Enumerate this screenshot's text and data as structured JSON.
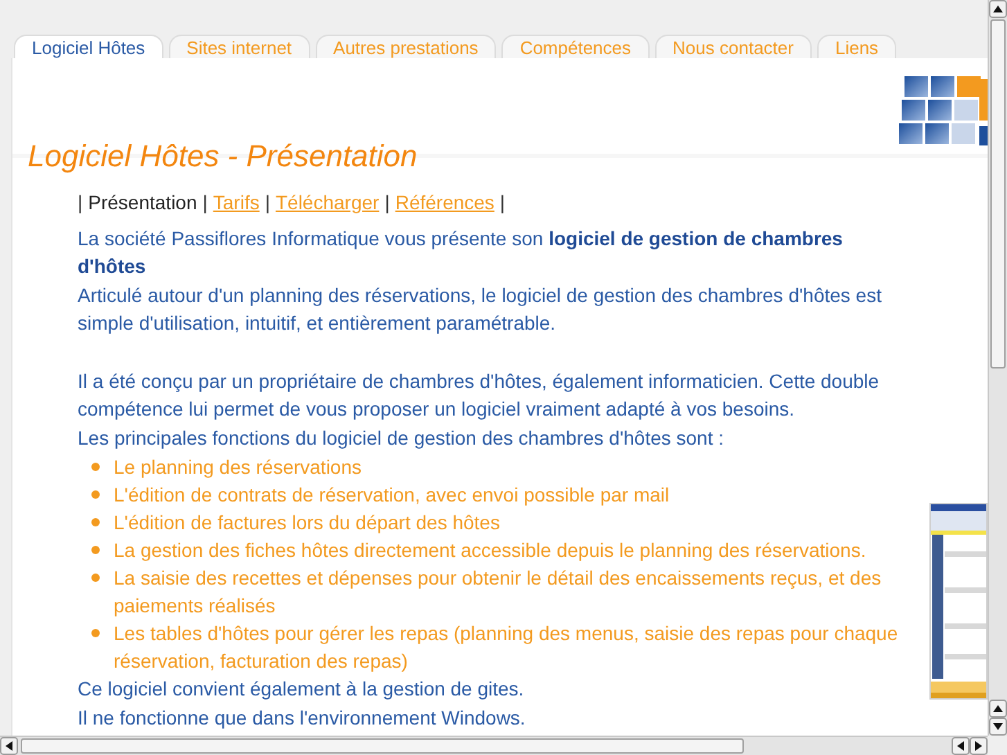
{
  "tabs": [
    {
      "label": "Logiciel Hôtes",
      "selected": true
    },
    {
      "label": "Sites internet",
      "selected": false
    },
    {
      "label": "Autres prestations",
      "selected": false
    },
    {
      "label": "Compétences",
      "selected": false
    },
    {
      "label": "Nous contacter",
      "selected": false
    },
    {
      "label": "Liens",
      "selected": false
    }
  ],
  "page_title": "Logiciel Hôtes - Présentation",
  "subnav": [
    {
      "kind": "separator",
      "text": "|"
    },
    {
      "kind": "link",
      "text": "Présentation",
      "selected": true
    },
    {
      "kind": "separator",
      "text": "|"
    },
    {
      "kind": "link",
      "text": "Tarifs",
      "selected": false
    },
    {
      "kind": "separator",
      "text": "|"
    },
    {
      "kind": "link",
      "text": "Télécharger",
      "selected": false
    },
    {
      "kind": "separator",
      "text": "|"
    },
    {
      "kind": "link",
      "text": "Références",
      "selected": false
    },
    {
      "kind": "separator",
      "text": "|"
    }
  ],
  "intro": [
    "La société Passiflores Informatique vous présente son **logiciel de gestion de chambres d'hôtes**",
    "Articulé autour d'un planning des réservations, le logiciel de gestion des chambres d'hôtes est simple d'utilisation, intuitif, et entièrement paramétrable.",
    "Il a été conçu par un propriétaire de chambres d'hôtes, également informaticien. Cette double compétence lui permet de vous proposer un logiciel vraiment adapté à vos besoins.",
    "Les principales fonctions du logiciel de gestion des chambres d'hôtes sont :"
  ],
  "features": [
    "Le planning des réservations",
    "L'édition de contrats de réservation, avec envoi possible par mail",
    "L'édition de factures lors du départ des hôtes",
    "La gestion des fiches hôtes directement accessible depuis le planning des réservations.",
    "La saisie des recettes et dépenses pour obtenir le détail des encaissements reçus, et des paiements réalisés",
    "Les tables d'hôtes pour gérer les repas (planning des menus, saisie des repas pour chaque réservation, facturation des repas)"
  ],
  "outro": [
    "Ce logiciel convient également à la gestion de gites.",
    "Il ne fonctionne que dans l'environnement Windows."
  ]
}
